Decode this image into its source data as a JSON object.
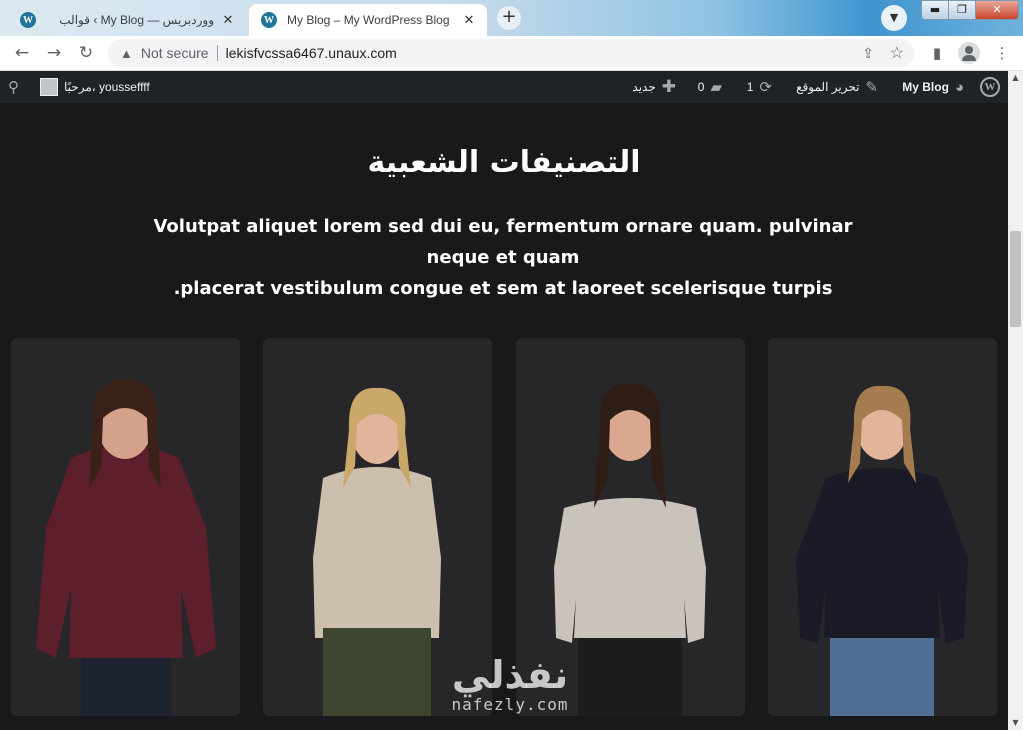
{
  "browser": {
    "tabs": [
      {
        "title": "قوالب ‹ My Blog — ووردبريس",
        "active": false
      },
      {
        "title": "My Blog – My WordPress Blog",
        "active": true
      }
    ],
    "security_label": "Not secure",
    "url": "lekisfvcssa6467.unaux.com"
  },
  "adminbar": {
    "site_name": "My Blog",
    "customize": "تحرير الموقع",
    "updates_count": "1",
    "comments_count": "0",
    "new_label": "جديد",
    "greeting": "مرحبًا، yousseffff"
  },
  "section": {
    "title": "التصنيفات الشعبية",
    "description_line1": "Volutpat aliquet lorem sed dui eu, fermentum ornare quam. pulvinar neque et quam",
    "description_line2": "placerat vestibulum congue et sem at laoreet scelerisque turpis."
  },
  "products": [
    {
      "name": "burgundy-blouse",
      "color": "#5c1f2b"
    },
    {
      "name": "beige-cold-shoulder-top",
      "color": "#cdbfae"
    },
    {
      "name": "grey-off-shoulder-sweater",
      "color": "#c9c3bb"
    },
    {
      "name": "navy-lace-blouse",
      "color": "#1a1b26"
    }
  ],
  "watermark": {
    "arabic": "نفذلي",
    "latin": "nafezly.com"
  }
}
